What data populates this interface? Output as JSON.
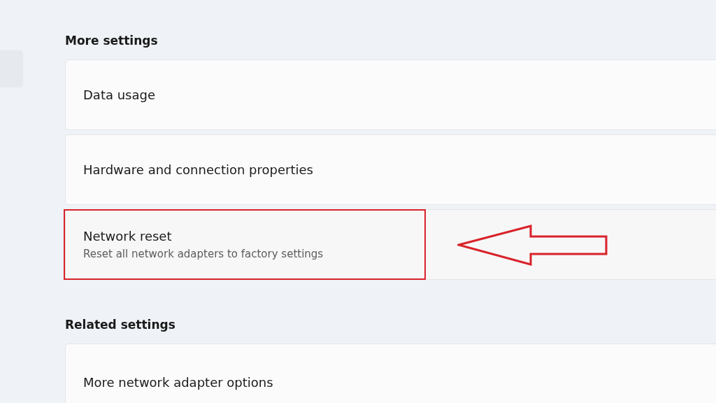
{
  "sections": [
    {
      "heading": "More settings",
      "items": [
        {
          "title": "Data usage",
          "highlighted": false
        },
        {
          "title": "Hardware and connection properties",
          "highlighted": false
        },
        {
          "title": "Network reset",
          "description": "Reset all network adapters to factory settings",
          "highlighted": true
        }
      ]
    },
    {
      "heading": "Related settings",
      "items": [
        {
          "title": "More network adapter options",
          "highlighted": false
        }
      ]
    }
  ]
}
